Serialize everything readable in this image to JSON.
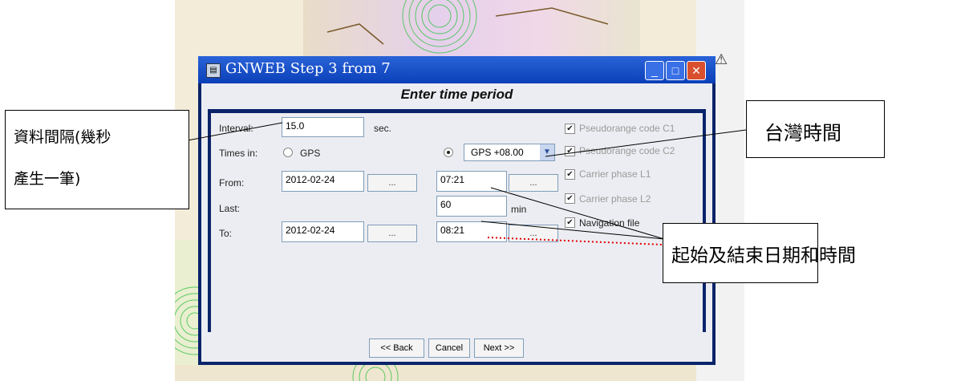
{
  "dialog": {
    "title": "GNWEB Step 3 from 7",
    "heading": "Enter time period",
    "interval_label": "Interval:",
    "interval_value": "15.0",
    "interval_unit": "sec.",
    "times_in_label": "Times in:",
    "radio_gps_label": "GPS",
    "timezone_selected": "GPS +08.00",
    "from_label": "From:",
    "from_date": "2012-02-24",
    "from_time": "07:21",
    "last_label": "Last:",
    "last_value": "60",
    "last_unit": "min",
    "to_label": "To:",
    "to_date": "2012-02-24",
    "to_time": "08:21",
    "picker_label": "...",
    "checkboxes": [
      {
        "label": "Pseudorange code C1",
        "checked": true
      },
      {
        "label": "Pseudorange code C2",
        "checked": true
      },
      {
        "label": "Carrier phase L1",
        "checked": true
      },
      {
        "label": "Carrier phase L2",
        "checked": true
      },
      {
        "label": "Navigation file",
        "checked": true
      }
    ],
    "back_label": "<< Back",
    "cancel_label": "Cancel",
    "next_label": "Next >>"
  },
  "annotations": {
    "interval_note_line1": "資料間隔(幾秒",
    "interval_note_line2": "產生一筆)",
    "timezone_note": "台灣時間",
    "datetime_note": "起始及結束日期和時間"
  },
  "icons": {
    "warning": "warning-icon"
  },
  "colors": {
    "titlebar": "#0a3fb8",
    "border": "#0a246a",
    "close": "#d9502e",
    "dotted": "#e00000"
  }
}
